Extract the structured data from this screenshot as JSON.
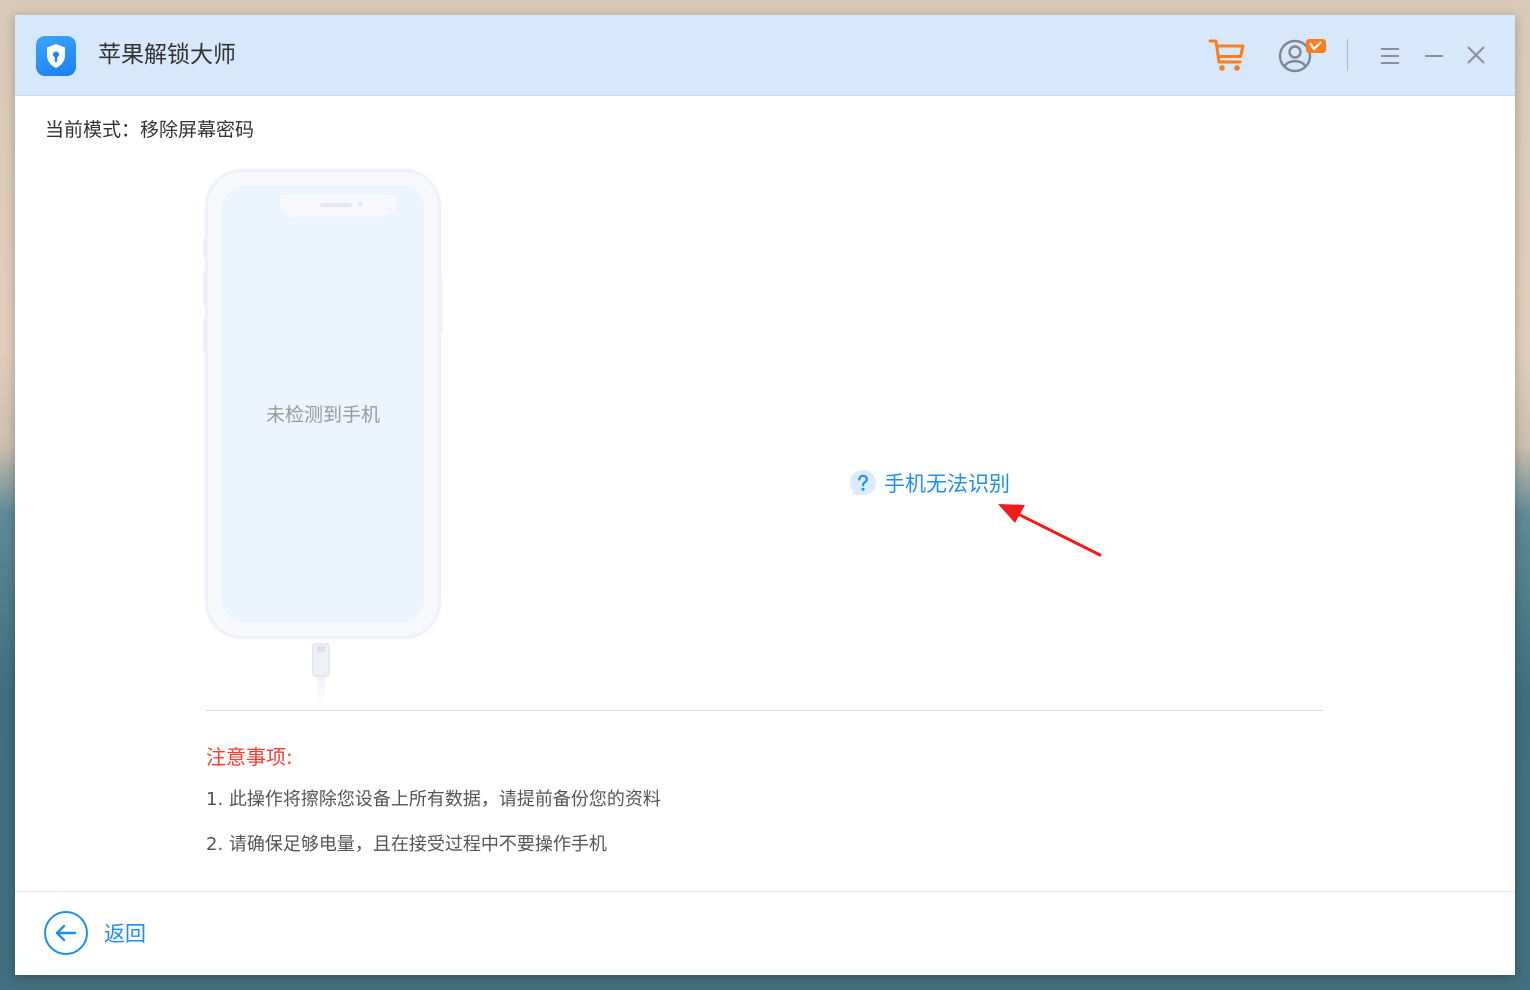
{
  "window": {
    "title": "苹果解锁大师"
  },
  "mode": {
    "text": "当前模式：移除屏幕密码"
  },
  "device": {
    "status": "未检测到手机"
  },
  "help": {
    "label": "手机无法识别"
  },
  "notes": {
    "title": "注意事项:",
    "items": [
      "1. 此操作将擦除您设备上所有数据，请提前备份您的资料",
      "2. 请确保足够电量，且在接受过程中不要操作手机"
    ]
  },
  "footer": {
    "back_label": "返回"
  },
  "icons": {
    "logo": "shield-lock-icon",
    "cart": "shopping-cart-icon",
    "user": "user-vip-icon",
    "menu": "menu-icon",
    "minimize": "minimize-icon",
    "close": "close-icon",
    "help": "question-bubble-icon",
    "back": "arrow-left-icon"
  },
  "colors": {
    "accent": "#1d8ff0",
    "titlebar": "#d7e8fc",
    "warning": "#ff3b30",
    "cart": "#ff7d1f",
    "annotation_arrow": "#f21a1a"
  }
}
